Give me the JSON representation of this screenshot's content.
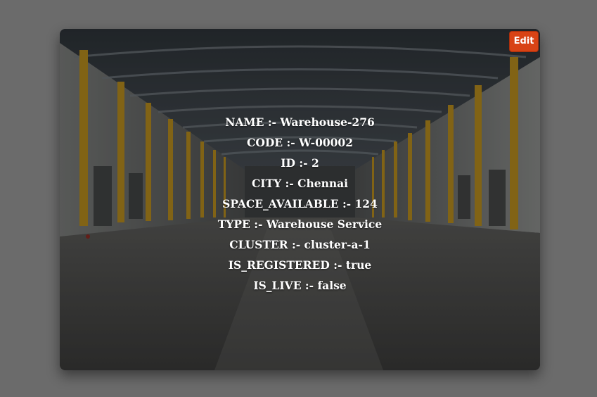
{
  "card": {
    "edit_label": "Edit",
    "fields": [
      {
        "label": "NAME",
        "separator": ":-",
        "value": "Warehouse-276"
      },
      {
        "label": "CODE",
        "separator": ":-",
        "value": "W-00002"
      },
      {
        "label": "ID",
        "separator": ":-",
        "value": "2"
      },
      {
        "label": "CITY",
        "separator": ":-",
        "value": "Chennai"
      },
      {
        "label": "SPACE_AVAILABLE",
        "separator": ":-",
        "value": "124"
      },
      {
        "label": "TYPE",
        "separator": ":-",
        "value": "Warehouse Service"
      },
      {
        "label": "CLUSTER",
        "separator": ":-",
        "value": "cluster-a-1"
      },
      {
        "label": "IS_REGISTERED",
        "separator": ":-",
        "value": "true"
      },
      {
        "label": "IS_LIVE",
        "separator": ":-",
        "value": "false"
      }
    ]
  },
  "colors": {
    "page_background": "#6b6b6b",
    "edit_button": "#d84315",
    "text": "#ffffff"
  }
}
